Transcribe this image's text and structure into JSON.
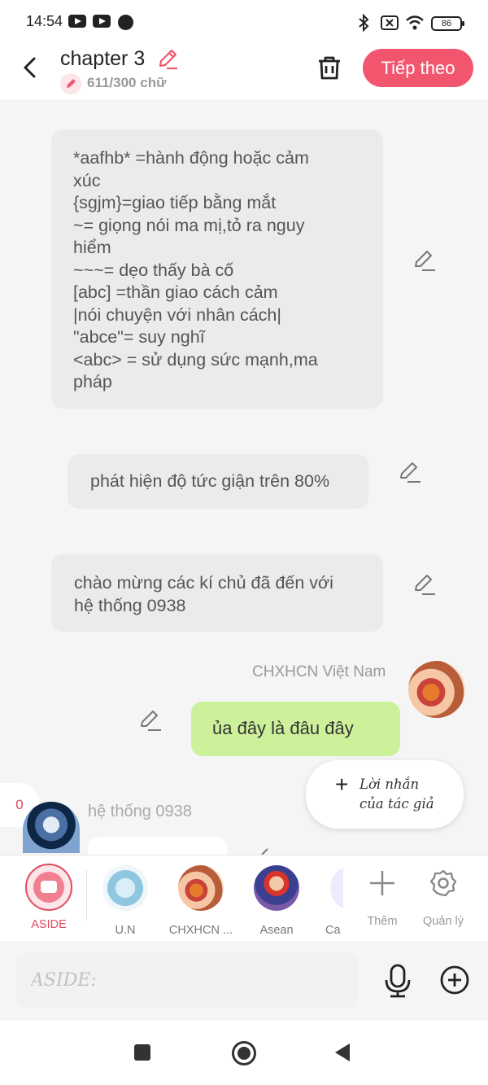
{
  "status_bar": {
    "time": "14:54",
    "battery": "86"
  },
  "header": {
    "title": "chapter 3",
    "word_count": "611/300 chữ",
    "next_button": "Tiếp theo"
  },
  "messages": {
    "legend_lines": [
      "*aafhb* =hành động hoặc cảm",
      "xúc",
      "{sgjm}=giao tiếp bằng mắt",
      "~= giọng nói ma mị,tỏ ra nguy",
      "hiểm",
      "~~~= dẹo thấy bà cố",
      "[abc] =thần giao cách cảm",
      "|nói chuyện với nhân cách|",
      "\"abce\"= suy nghĩ",
      "<abc> = sử dụng sức mạnh,ma",
      "pháp"
    ],
    "anger_text": "phát hiện độ tức giận trên 80%",
    "welcome_lines": [
      "chào mừng các kí chủ đã đến với",
      "hệ thống 0938"
    ],
    "user_name": "CHXHCN Việt Nam",
    "user_text": "ủa đây là đâu đây",
    "unread_count": "0",
    "system_name": "hệ thống 0938"
  },
  "author_note": {
    "lines": [
      "Lời nhắn",
      "của tác giả"
    ]
  },
  "characters": [
    {
      "label": "ASIDE",
      "active": true
    },
    {
      "label": "U.N"
    },
    {
      "label": "CHXHCN ..."
    },
    {
      "label": "Asean"
    },
    {
      "label": "Ca"
    }
  ],
  "actions": {
    "add_label": "Thêm",
    "manage_label": "Quản lý"
  },
  "input": {
    "placeholder": "ASIDE:"
  },
  "colors": {
    "accent": "#f2566e",
    "user_bubble": "#cdf19b",
    "bubble": "#ebebeb"
  }
}
